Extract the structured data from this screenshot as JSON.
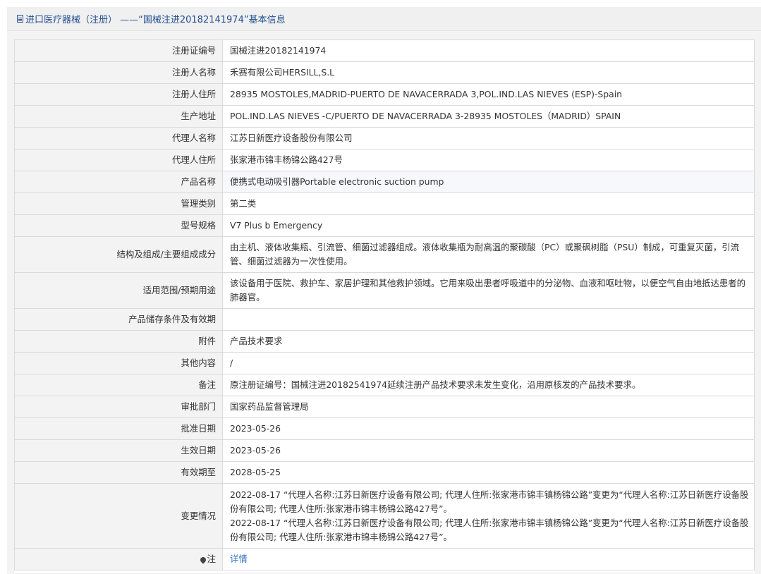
{
  "header": {
    "title": "进口医疗器械（注册） ——“国械注进20182141974”基本信息"
  },
  "rows": [
    {
      "label": "注册证编号",
      "value": "国械注进20182141974"
    },
    {
      "label": "注册人名称",
      "value": "禾赛有限公司HERSILL,S.L"
    },
    {
      "label": "注册人住所",
      "value": "28935 MOSTOLES,MADRID-PUERTO DE NAVACERRADA 3,POL.IND.LAS NIEVES (ESP)-Spain"
    },
    {
      "label": "生产地址",
      "value": "POL.IND.LAS NIEVES -C/PUERTO DE NAVACERRADA 3-28935 MOSTOLES（MADRID）SPAIN"
    },
    {
      "label": "代理人名称",
      "value": "江苏日新医疗设备股份有限公司"
    },
    {
      "label": "代理人住所",
      "value": "张家港市锦丰杨锦公路427号"
    },
    {
      "label": "产品名称",
      "value": "便携式电动吸引器Portable electronic suction pump"
    },
    {
      "label": "管理类别",
      "value": "第二类"
    },
    {
      "label": "型号规格",
      "value": "V7 Plus b Emergency"
    },
    {
      "label": "结构及组成/主要组成成分",
      "value": "由主机、液体收集瓶、引流管、细菌过滤器组成。液体收集瓶为耐高温的聚碳酸（PC）或聚砜树脂（PSU）制成，可重复灭菌，引流管、细菌过滤器为一次性使用。"
    },
    {
      "label": "适用范围/预期用途",
      "value": "该设备用于医院、救护车、家居护理和其他救护领域。它用来吸出患者呼吸道中的分泌物、血液和呕吐物，以便空气自由地抵达患者的肺器官。"
    },
    {
      "label": "产品储存条件及有效期",
      "value": ""
    },
    {
      "label": "附件",
      "value": "产品技术要求"
    },
    {
      "label": "其他内容",
      "value": "/"
    },
    {
      "label": "备注",
      "value": "原注册证编号：国械注进20182541974延续注册产品技术要求未发生变化，沿用原核发的产品技术要求。"
    },
    {
      "label": "审批部门",
      "value": "国家药品监督管理局"
    },
    {
      "label": "批准日期",
      "value": "2023-05-26"
    },
    {
      "label": "生效日期",
      "value": "2023-05-26"
    },
    {
      "label": "有效期至",
      "value": "2028-05-25"
    }
  ],
  "changes": {
    "label": "变更情况",
    "entries": [
      "2022-08-17 “代理人名称:江苏日新医疗设备有限公司; 代理人住所:张家港市锦丰镇杨锦公路”变更为“代理人名称:江苏日新医疗设备股份有限公司; 代理人住所:张家港市锦丰杨锦公路427号”。",
      "2022-08-17 “代理人名称:江苏日新医疗设备有限公司; 代理人住所:张家港市锦丰镇杨锦公路”变更为“代理人名称:江苏日新医疗设备股份有限公司; 代理人住所:张家港市锦丰杨锦公路427号”。"
    ]
  },
  "note": {
    "label": "注",
    "icon": "pin-icon",
    "link": "详情"
  }
}
